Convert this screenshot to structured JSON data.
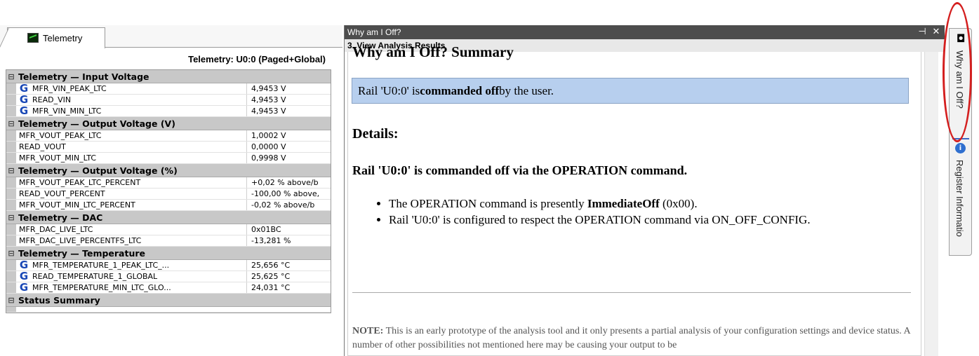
{
  "telemetry": {
    "tab_label": "Telemetry",
    "grid_title": "Telemetry: U0:0 (Paged+Global)",
    "categories": [
      {
        "label": "Telemetry — Input Voltage",
        "rows": [
          {
            "name": "MFR_VIN_PEAK_LTC",
            "value": "4,9453 V",
            "global": true
          },
          {
            "name": "READ_VIN",
            "value": "4,9453 V",
            "global": true
          },
          {
            "name": "MFR_VIN_MIN_LTC",
            "value": "4,9453 V",
            "global": true
          }
        ]
      },
      {
        "label": "Telemetry — Output Voltage (V)",
        "rows": [
          {
            "name": "MFR_VOUT_PEAK_LTC",
            "value": "1,0002 V",
            "global": false
          },
          {
            "name": "READ_VOUT",
            "value": "0,0000 V",
            "global": false
          },
          {
            "name": "MFR_VOUT_MIN_LTC",
            "value": "0,9998 V",
            "global": false
          }
        ]
      },
      {
        "label": "Telemetry — Output Voltage (%)",
        "rows": [
          {
            "name": "MFR_VOUT_PEAK_LTC_PERCENT",
            "value": "+0,02 % above/b",
            "global": false
          },
          {
            "name": "READ_VOUT_PERCENT",
            "value": "-100,00 % above,",
            "global": false
          },
          {
            "name": "MFR_VOUT_MIN_LTC_PERCENT",
            "value": "-0,02 % above/b",
            "global": false
          }
        ]
      },
      {
        "label": "Telemetry — DAC",
        "rows": [
          {
            "name": "MFR_DAC_LIVE_LTC",
            "value": "0x01BC",
            "global": false
          },
          {
            "name": "MFR_DAC_LIVE_PERCENTFS_LTC",
            "value": "-13,281 %",
            "global": false
          }
        ]
      },
      {
        "label": "Telemetry — Temperature",
        "rows": [
          {
            "name": "MFR_TEMPERATURE_1_PEAK_LTC_...",
            "value": "25,656 °C",
            "global": true
          },
          {
            "name": "READ_TEMPERATURE_1_GLOBAL",
            "value": "25,625 °C",
            "global": true
          },
          {
            "name": "MFR_TEMPERATURE_MIN_LTC_GLO...",
            "value": "24,031 °C",
            "global": true
          }
        ]
      },
      {
        "label": "Status Summary",
        "rows": []
      }
    ]
  },
  "why_panel": {
    "title": "Why am I Off?",
    "step_header": "3. View Analysis Results",
    "summary_title": "Why am I Off? Summary",
    "summary": {
      "prefix": "Rail 'U0:0' is ",
      "bold": "commanded off",
      "suffix": " by the user."
    },
    "details_heading": "Details:",
    "command_heading": "Rail 'U0:0' is commanded off via the OPERATION command.",
    "bullets": [
      {
        "prefix": "The OPERATION command is presently ",
        "bold": "ImmediateOff",
        "suffix": " (0x00)."
      },
      {
        "prefix": "Rail 'U0:0' is configured to respect the OPERATION command via ON_OFF_CONFIG.",
        "bold": "",
        "suffix": ""
      }
    ],
    "note_label": "NOTE:",
    "note_text": " This is an early prototype of the analysis tool and it only presents a partial analysis of your configuration settings and device status. A number of other possibilities not mentioned here may be causing your output to be",
    "pin_glyph": "⊣",
    "close_glyph": "✕"
  },
  "dock": {
    "why_tab_label": "Why am I Off?",
    "register_tab_label": "Register Informatio"
  },
  "colors": {
    "summary_box": "#b7cfee",
    "title_bar": "#4d4d4d",
    "highlight": "#d41f1f",
    "category_row": "#c8c8c8"
  }
}
